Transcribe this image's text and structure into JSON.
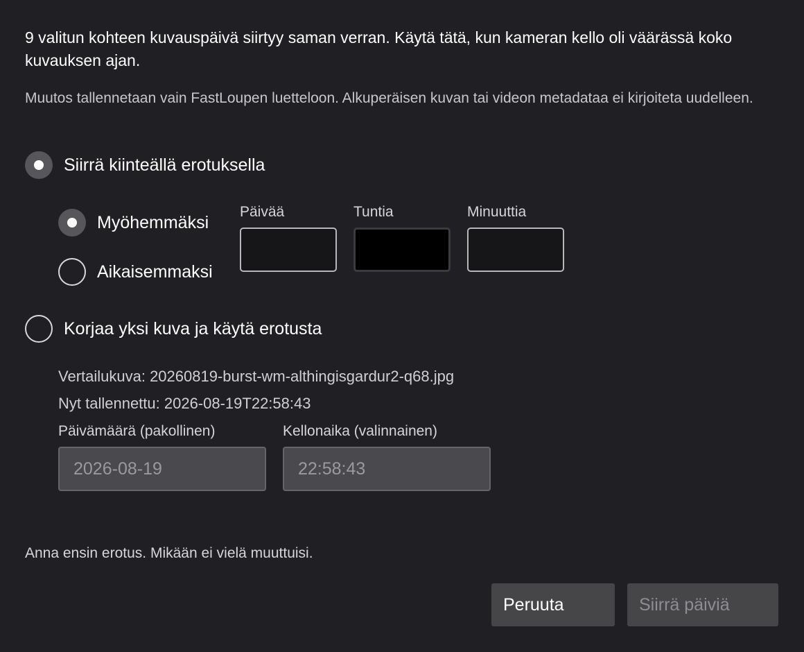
{
  "intro": "9 valitun kohteen kuvauspäivä siirtyy saman verran. Käytä tätä, kun kameran kello oli väärässä koko kuvauksen ajan.",
  "note": "Muutos tallennetaan vain FastLoupen luetteloon. Alkuperäisen kuvan tai videon metadataa ei kirjoiteta uudelleen.",
  "mode_fixed": {
    "label": "Siirrä kiinteällä erotuksella",
    "selected": true
  },
  "direction": {
    "later": {
      "label": "Myöhemmäksi",
      "selected": true
    },
    "earlier": {
      "label": "Aikaisemmaksi",
      "selected": false
    }
  },
  "offset_fields": {
    "days": {
      "label": "Päivää",
      "value": ""
    },
    "hours": {
      "label": "Tuntia",
      "value": ""
    },
    "minutes": {
      "label": "Minuuttia",
      "value": ""
    }
  },
  "mode_reference": {
    "label": "Korjaa yksi kuva ja käytä erotusta",
    "selected": false
  },
  "reference": {
    "file_text": "Vertailukuva: 20260819-burst-wm-althingisgardur2-q68.jpg",
    "saved_text": "Nyt tallennettu: 2026-08-19T22:58:43",
    "date_label": "Päivämäärä (pakollinen)",
    "date_value": "2026-08-19",
    "time_label": "Kellonaika (valinnainen)",
    "time_value": "22:58:43"
  },
  "status": "Anna ensin erotus. Mikään ei vielä muuttuisi.",
  "buttons": {
    "cancel": "Peruuta",
    "apply": "Siirrä päiviä"
  }
}
